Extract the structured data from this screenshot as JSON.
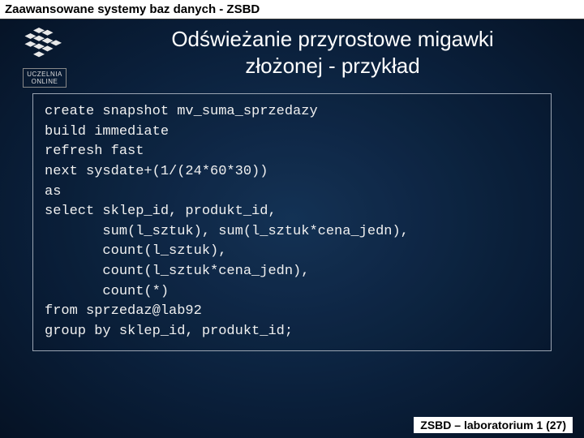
{
  "header": "Zaawansowane systemy baz danych - ZSBD",
  "logo": {
    "label_line1": "UCZELNIA",
    "label_line2": "ONLINE"
  },
  "title": {
    "line1": "Odświeżanie przyrostowe migawki",
    "line2": "złożonej - przykład"
  },
  "code": {
    "l1": "create snapshot mv_suma_sprzedazy",
    "l2": "build immediate",
    "l3": "refresh fast",
    "l4": "next sysdate+(1/(24*60*30))",
    "l5": "as",
    "l6": "select sklep_id, produkt_id,",
    "l7": "       sum(l_sztuk), sum(l_sztuk*cena_jedn),",
    "l8": "       count(l_sztuk),",
    "l9": "       count(l_sztuk*cena_jedn),",
    "l10": "       count(*)",
    "l11": "from sprzedaz@lab92",
    "l12": "group by sklep_id, produkt_id;"
  },
  "footer": "ZSBD – laboratorium 1 (27)"
}
